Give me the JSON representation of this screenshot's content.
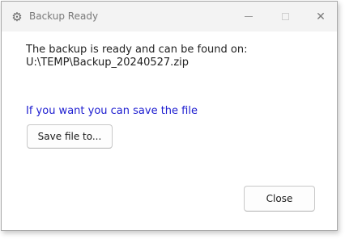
{
  "window": {
    "title": "Backup Ready",
    "icon": "gears-icon"
  },
  "caption_buttons": {
    "minimize_icon": "minimize-icon",
    "maximize_icon": "maximize-icon",
    "close_symbol": "✕"
  },
  "content": {
    "message": "The backup is ready and can be found on:",
    "path": "U:\\TEMP\\Backup_20240527.zip",
    "hint": "If you want you can save the file",
    "save_button_label": "Save file to...",
    "close_button_label": "Close"
  },
  "colors": {
    "hint_text": "#1c1cd0",
    "titlebar_bg": "#f3f3f3"
  }
}
